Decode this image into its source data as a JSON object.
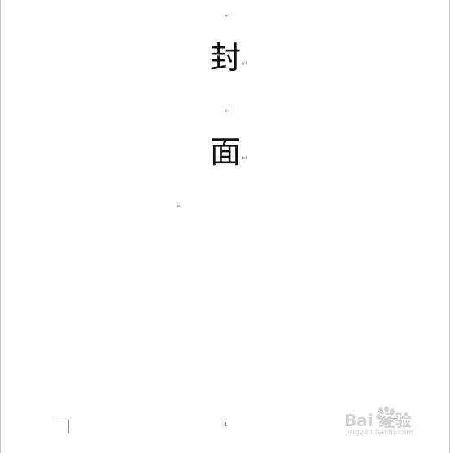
{
  "document": {
    "paragraph_mark": "↵",
    "title_char_1": "封",
    "title_char_2": "面",
    "footer_page_number": "1"
  },
  "watermark": {
    "text": "Bai  经验",
    "sub": "jingyan.baidu.com"
  }
}
